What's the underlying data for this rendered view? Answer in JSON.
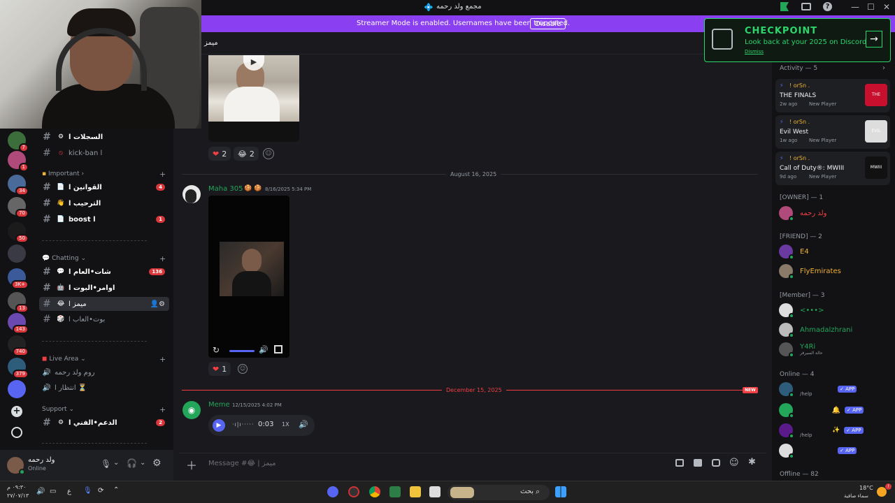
{
  "window": {
    "title": "مجمع ولد رحمه",
    "minimize": "—",
    "maximize": "☐",
    "close": "✕"
  },
  "banner": {
    "text": "Streamer Mode is enabled. Usernames have been truncated.",
    "button": "Disable"
  },
  "checkpoint": {
    "title": "CHECKPOINT",
    "subtitle": "Look back at your 2025 on Discord",
    "dismiss": "Dismiss"
  },
  "chat_header": {
    "channel": "ميمز ا"
  },
  "servers": [
    {
      "badge": "7",
      "color": "#3b6e3a"
    },
    {
      "badge": "1",
      "color": "#b04a7a"
    },
    {
      "badge": "34",
      "color": "#4a6a9a"
    },
    {
      "badge": "70",
      "color": "#666"
    },
    {
      "badge": "50",
      "color": "#1b1b1b"
    },
    {
      "badge": "",
      "color": "#3a3a44"
    },
    {
      "badge": "3K+",
      "color": "#3b5a9a"
    },
    {
      "badge": "13",
      "color": "#555"
    },
    {
      "badge": "143",
      "color": "#6a4ab0"
    },
    {
      "badge": "740",
      "color": "#222"
    },
    {
      "badge": "379",
      "color": "#2d5d7a"
    },
    {
      "badge": "",
      "color": "#5865f2"
    }
  ],
  "sidebar": {
    "channels_top": [
      {
        "name": "السجلات ا",
        "emoji": "⚙",
        "badge": ""
      },
      {
        "name": "kick-ban ا",
        "emoji": "⦸",
        "badge": ""
      }
    ],
    "cat_important": "Important",
    "important": [
      {
        "name": "القوانين ا",
        "emoji": "📄",
        "badge": "4"
      },
      {
        "name": "الترحيب ا",
        "emoji": "👋",
        "badge": ""
      },
      {
        "name": "boost ا",
        "emoji": "📄",
        "badge": "1"
      }
    ],
    "cat_chatting": "Chatting",
    "chatting": [
      {
        "name": "شات•العام ا",
        "emoji": "💬",
        "badge": "136"
      },
      {
        "name": "اوامر•البوت ا",
        "emoji": "🤖",
        "badge": ""
      },
      {
        "name": "ميمز ا",
        "emoji": "😂",
        "badge": ""
      },
      {
        "name": "بوت•العاب ا",
        "emoji": "🎲",
        "badge": ""
      }
    ],
    "cat_live": "Live Area",
    "live": [
      {
        "name": "روم ولد رحمه",
        "emoji": "🔊"
      },
      {
        "name": "انتظار ا ⏳",
        "emoji": "🔊"
      }
    ],
    "cat_support": "Support",
    "support": [
      {
        "name": "الدعم•الفني ا",
        "emoji": "⚙",
        "badge": "2"
      }
    ]
  },
  "user": {
    "name": "ولد رحمه",
    "status": "Online"
  },
  "messages": {
    "reactions1": [
      {
        "emoji": "❤",
        "count": "2"
      },
      {
        "emoji": "😂",
        "count": "2"
      }
    ],
    "date1": "August 16, 2025",
    "msg2": {
      "author": "Maha 305",
      "emoji": "🍪 🍪",
      "time": "8/16/2025 5:34 PM"
    },
    "reactions2": [
      {
        "emoji": "❤",
        "count": "1"
      }
    ],
    "date2": "December 15, 2025",
    "new_label": "NEW",
    "msg3": {
      "author": "Meme",
      "time": "12/15/2025 4:02 PM",
      "audio_time": "0:03",
      "speed": "1X"
    }
  },
  "composer": {
    "placeholder": "Message #😂 | ميمز"
  },
  "members": {
    "activity_header": "Activity — 5",
    "activities": [
      {
        "user": "! orSn .",
        "game": "THE FINALS",
        "ago": "2w ago",
        "tag": "New Player",
        "thumb": "THE FINALS",
        "color": "#c8102e"
      },
      {
        "user": "! orSn .",
        "game": "Evil West",
        "ago": "1w ago",
        "tag": "New Player",
        "thumb": "EVIL WEST",
        "color": "#ddd"
      },
      {
        "user": "! orSn .",
        "game": "Call of Duty®: MWIII",
        "ago": "9d ago",
        "tag": "New Player",
        "thumb": "MWIII",
        "color": "#111"
      }
    ],
    "owner_header": "[OWNER] — 1",
    "owner": [
      {
        "name": "ولد رحمه",
        "color": "#f23f43"
      }
    ],
    "friend_header": "[FRIEND] — 2",
    "friends": [
      {
        "name": "E4",
        "color": "#f0b232"
      },
      {
        "name": "FlyEmirates",
        "color": "#f0b232"
      }
    ],
    "member_header": "[Member] — 3",
    "member": [
      {
        "name": "<•••>",
        "sub": "",
        "color": "#23a55a"
      },
      {
        "name": "Ahmadalzhrani",
        "sub": "",
        "color": "#23a55a"
      },
      {
        "name": "Y4Ri",
        "sub": "حالة السيرفر",
        "color": "#23a55a"
      }
    ],
    "online_header": "Online — 4",
    "online": [
      {
        "sub": "/help",
        "app": "✓ APP"
      },
      {
        "sub": "",
        "app": "✓ APP"
      },
      {
        "sub": "/help",
        "app": "✓ APP"
      },
      {
        "sub": "",
        "app": "✓ APP"
      }
    ],
    "offline_header": "Offline — 82"
  },
  "taskbar": {
    "time": "٠٩:٣٠ م",
    "date": "٢٧/٠٧/١٣",
    "lang": "ع",
    "search": "بحث",
    "weather_temp": "18°C",
    "weather_text": "سماء صافية"
  }
}
